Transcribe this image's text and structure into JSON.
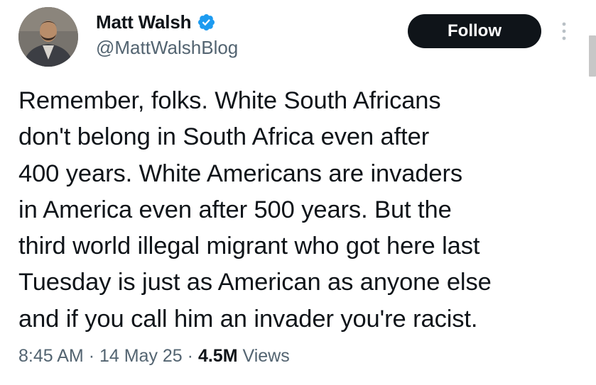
{
  "author": {
    "display_name": "Matt Walsh",
    "handle": "@MattWalshBlog",
    "verified": true,
    "verified_color": "#1d9bf0",
    "avatar_icon": "avatar-photo"
  },
  "follow_button": {
    "label": "Follow",
    "background": "#0f1419",
    "text_color": "#ffffff"
  },
  "more_menu_icon": "vertical-ellipsis-icon",
  "tweet": {
    "text": "Remember, folks. White South Africans\ndon't belong in South Africa even after\n400 years. White Americans are invaders\nin America even after 500 years. But the\nthird world illegal migrant who got here last\nTuesday is just as American as anyone else\nand if you call him an invader you're racist."
  },
  "meta": {
    "time": "8:45 AM",
    "separator": "·",
    "date": "14 May 25",
    "views_count": "4.5M",
    "views_label": "Views"
  },
  "colors": {
    "text_primary": "#0f1419",
    "text_secondary": "#536471"
  }
}
